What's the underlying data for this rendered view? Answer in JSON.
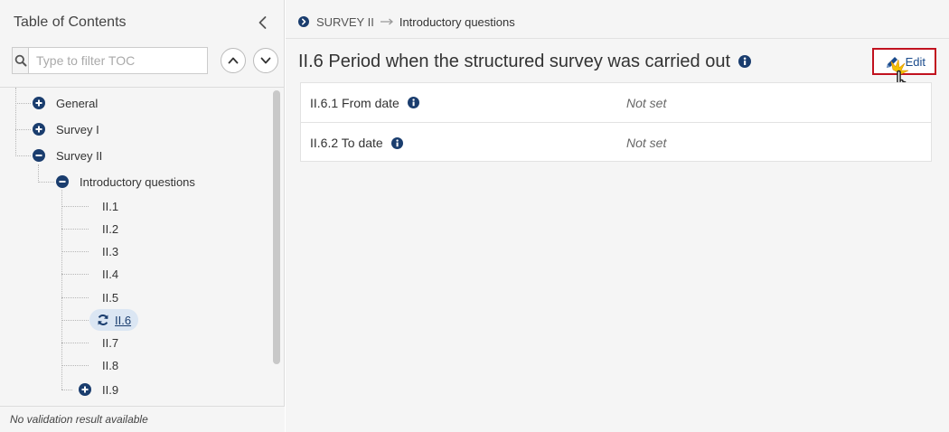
{
  "sidebar": {
    "title": "Table of Contents",
    "filter_placeholder": "Type to filter TOC",
    "tree": {
      "general": "General",
      "survey1": "Survey I",
      "survey2": "Survey II",
      "intro": "Introductory questions",
      "children": [
        "II.1",
        "II.2",
        "II.3",
        "II.4",
        "II.5",
        "II.6",
        "II.7",
        "II.8",
        "II.9"
      ]
    },
    "status": "No validation result available"
  },
  "breadcrumb": {
    "first": "SURVEY II",
    "second": "Introductory questions"
  },
  "section": {
    "title": "II.6 Period when the structured survey was carried out",
    "edit_label": "Edit"
  },
  "fields": [
    {
      "label": "II.6.1 From date",
      "value": "Not set"
    },
    {
      "label": "II.6.2 To date",
      "value": "Not set"
    }
  ],
  "colors": {
    "brand_blue": "#1a3d6e",
    "highlight_red": "#c1121f",
    "active_bg": "#dbe6f3"
  },
  "icons": {
    "collapse": "chevron-left-icon",
    "search": "search-icon",
    "up": "chevron-up-icon",
    "down": "chevron-down-icon",
    "expand": "plus-circle-icon",
    "collapse_node": "minus-circle-icon",
    "refresh": "refresh-icon",
    "info": "info-icon",
    "edit": "pencil-icon",
    "cursor": "hand-cursor-icon"
  }
}
